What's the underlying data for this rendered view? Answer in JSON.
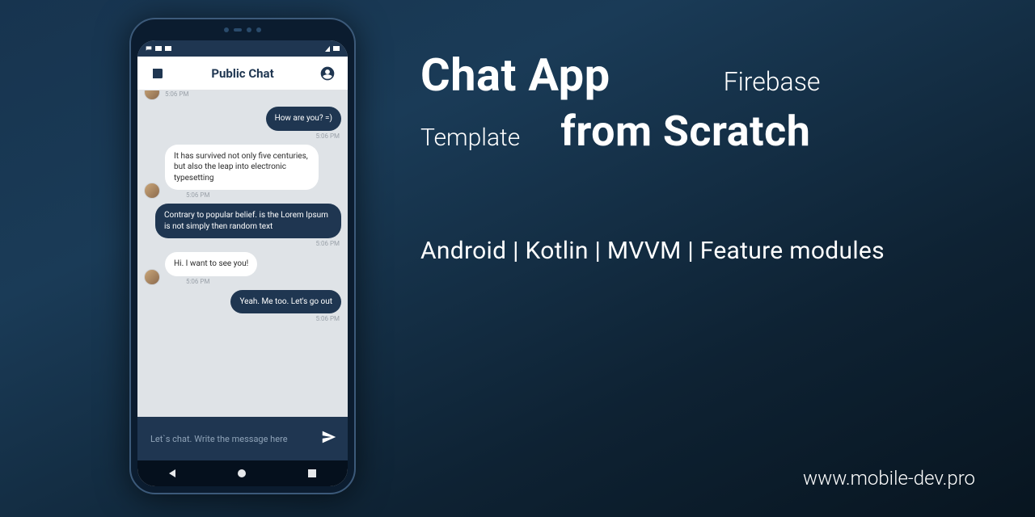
{
  "hero": {
    "title1": "Chat App",
    "badge1": "Firebase",
    "badge2": "Template",
    "title2": "from Scratch",
    "tags": "Android | Kotlin | MVVM | Feature modules"
  },
  "footer_url": "www.mobile-dev.pro",
  "phone": {
    "header_title": "Public Chat",
    "cutoff_time": "5:06 PM",
    "messages": [
      {
        "kind": "outgoing",
        "style": "dark",
        "text": "How are you? =)",
        "time": "5:06 PM"
      },
      {
        "kind": "incoming",
        "style": "light",
        "text": "It has survived not only five centuries, but also the leap into electronic typesetting",
        "time": "5:06 PM"
      },
      {
        "kind": "outgoing",
        "style": "dark",
        "text": "Contrary to popular belief. is the Lorem Ipsum is not simply then random text",
        "time": "5:06 PM"
      },
      {
        "kind": "incoming",
        "style": "light",
        "text": "Hi. I want to see you!",
        "time": "5:06 PM"
      },
      {
        "kind": "outgoing",
        "style": "dark",
        "text": "Yeah. Me too. Let's go out",
        "time": "5:06 PM"
      }
    ],
    "input_placeholder": "Let`s chat. Write the message here"
  }
}
